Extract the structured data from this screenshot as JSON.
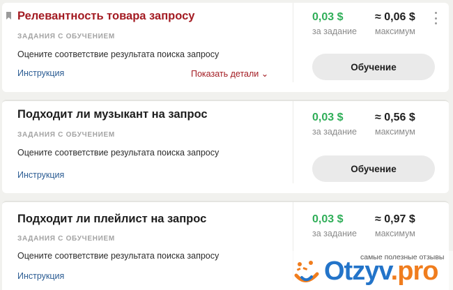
{
  "tasks": [
    {
      "title": "Релевантность товара запросу",
      "category": "ЗАДАНИЯ С ОБУЧЕНИЕМ",
      "description": "Оцените соответствие результата поиска запросу",
      "instruction_label": "Инструкция",
      "details_label": "Показать детали ⌄",
      "price": "0,03 $",
      "price_caption": "за задание",
      "max": "≈ 0,06 $",
      "max_caption": "максимум",
      "button_label": "Обучение",
      "bookmarked": true,
      "title_color": "#a31b22"
    },
    {
      "title": "Подходит ли музыкант на запрос",
      "category": "ЗАДАНИЯ С ОБУЧЕНИЕМ",
      "description": "Оцените соответствие результата поиска запросу",
      "instruction_label": "Инструкция",
      "price": "0,03 $",
      "price_caption": "за задание",
      "max": "≈ 0,56 $",
      "max_caption": "максимум",
      "button_label": "Обучение"
    },
    {
      "title": "Подходит ли плейлист на запрос",
      "category": "ЗАДАНИЯ С ОБУЧЕНИЕМ",
      "description": "Оцените соответствие результата поиска запросу",
      "instruction_label": "Инструкция",
      "price": "0,03 $",
      "price_caption": "за задание",
      "max": "≈ 0,97 $",
      "max_caption": "максимум"
    }
  ],
  "watermark": {
    "tagline": "самые полезные отзывы",
    "brand": "Otzyv",
    "brand_ext": ".pro"
  },
  "colors": {
    "price_green": "#2fae58",
    "link_blue": "#2b5c93",
    "accent_red": "#a31b22",
    "button_gray": "#eaeaea",
    "brand_blue": "#2374c9",
    "brand_orange": "#f07d1e"
  },
  "icons": {
    "bookmark": "bookmark-icon",
    "menu": "more-vertical-icon",
    "brand_logo": "otzyv-logo-icon"
  }
}
